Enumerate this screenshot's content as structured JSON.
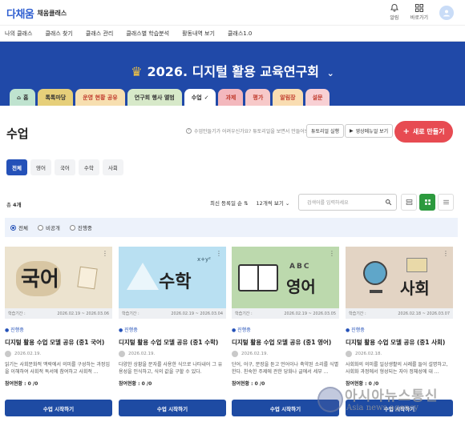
{
  "app": {
    "logo_mark": "다채움",
    "logo_text": "채움클래스"
  },
  "header_icons": [
    {
      "label": "알림"
    },
    {
      "label": "바로가기"
    }
  ],
  "nav": [
    "나의 클래스",
    "클래스 찾기",
    "클래스 관리",
    "클래스별 학습분석",
    "활동내역 보기",
    "클래스1.0"
  ],
  "hero": {
    "title": "2026. 디지털 활용 교육연구회",
    "bg_color": "#2049a8"
  },
  "tabs": [
    {
      "label": "홈",
      "color": "#bfe3cf"
    },
    {
      "label": "톡톡마당",
      "color": "#e6cf7a"
    },
    {
      "label": "운영 현황 공유",
      "color": "#f7dfb0"
    },
    {
      "label": "연구회 행사 앨범",
      "color": "#d7e9c9"
    },
    {
      "label": "수업",
      "color": "#ffffff",
      "active": true
    },
    {
      "label": "과제",
      "color": "#f3b8bd"
    },
    {
      "label": "평가",
      "color": "#f7c9c9"
    },
    {
      "label": "알림장",
      "color": "#f9ddb2"
    },
    {
      "label": "설문",
      "color": "#f8d0d4"
    }
  ],
  "page": {
    "title": "수업",
    "helper": "수업만들기가 어려우신가요? 튜토리얼을 보면서 만들어보세요",
    "tutorial_button": "튜토리얼 실행",
    "video_button": "영상메뉴얼 보기",
    "new_button": "새로 만들기"
  },
  "filters": [
    "전체",
    "영어",
    "국어",
    "수학",
    "사회"
  ],
  "list": {
    "count_label": "총 ",
    "count_value": "4개",
    "sort": "최신 등록일 순",
    "per_page": "12개씩 보기",
    "search_placeholder": "검색어를 입력하세요"
  },
  "radios": [
    "전체",
    "비공개",
    "진행중"
  ],
  "cards": [
    {
      "thumb_label": "국어",
      "thumb_color": "#ece3cf",
      "period_label": "학습기간 :",
      "period": "2026.02.19 ~ 2026.03.06",
      "status": "진행중",
      "title": "디지털 활용 수업 모델 공유 (중1 국어)",
      "date": "2026.02.19.",
      "desc": "읽기는 사회문화적 맥락에서 의미를 구성하는 과정임을 이해하여 사회적 독서에 참여하고 사회적 ...",
      "participation": "참여현황 : 0 /0",
      "button": "수업 시작하기"
    },
    {
      "thumb_label": "수학",
      "thumb_color": "#b9e0f2",
      "period_label": "학습기간 :",
      "period": "2026.02.19 ~ 2026.03.04",
      "status": "진행중",
      "title": "디지털 활용 수업 모델 공유 (중1 수학)",
      "date": "2026.02.19.",
      "desc": "다양한 상황을 문자를 사용한 식으로 나타내어 그 유용성을 인식하고, 식의 값을 구할 수 있다.",
      "participation": "참여현황 : 0 /0",
      "button": "수업 시작하기"
    },
    {
      "thumb_label": "영어",
      "thumb_color": "#bcd9ad",
      "period_label": "학습기간 :",
      "period": "2026.02.19 ~ 2026.03.05",
      "status": "진행중",
      "title": "디지털 활용 수업 모델 공유 (중1 영어)",
      "date": "2026.02.19.",
      "desc": "단어, 어구, 문장을 듣고 언어이나 축약된 소리를 식별한다. 친숙한 주제에 관한 당화나 글에서 세부 ...",
      "participation": "참여현황 : 0 /0",
      "button": "수업 시작하기"
    },
    {
      "thumb_label": "사회",
      "thumb_color": "#e3d4c4",
      "period_label": "학습기간 :",
      "period": "2026.02.18 ~ 2026.03.07",
      "status": "진행중",
      "title": "디지털 활용 수업 모델 공유 (중1 사회)",
      "date": "2026.02.18.",
      "desc": "사회화의 의미를 일상생활의 사례를 들어 설명하고, 사회화 과정에서 형성되는 자아 정체성에 대 ...",
      "participation": "참여현황 : 0 /0",
      "button": "수업 시작하기"
    }
  ],
  "watermark": {
    "text": "아시아뉴스통신",
    "sub": "Asia news agency"
  },
  "colors": {
    "primary": "#2451b8",
    "new_button": "#e74b52",
    "active_view": "#2c9a3e",
    "card_button": "#1e4ba3"
  }
}
